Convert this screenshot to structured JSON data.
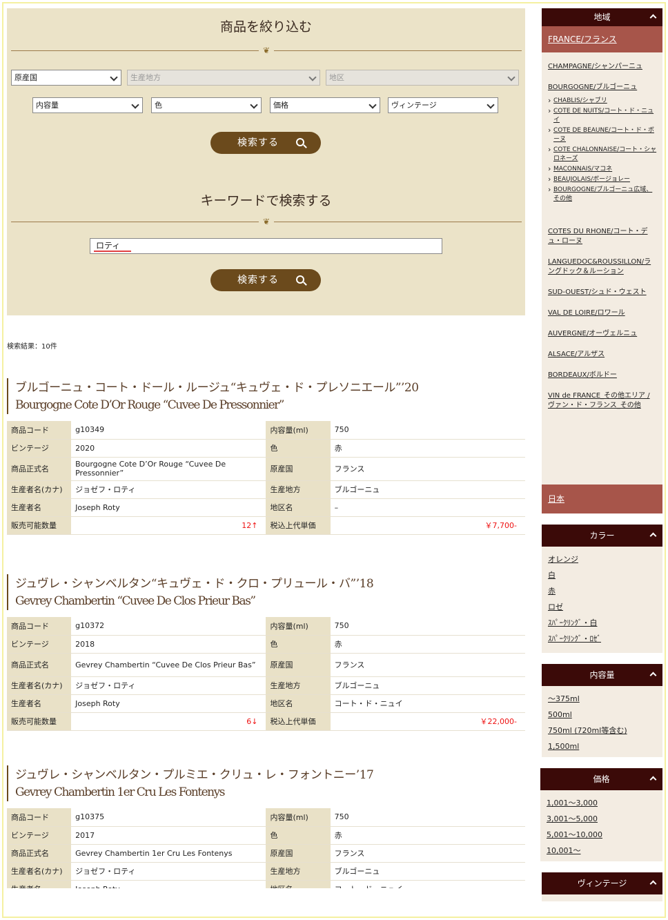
{
  "filter": {
    "title": "商品を絞り込む",
    "country": "原産国",
    "region": "生産地方",
    "district": "地区",
    "volume": "内容量",
    "color": "色",
    "price": "価格",
    "vintage": "ヴィンテージ",
    "search_label": "検索する",
    "keyword_title": "キーワードで検索する",
    "keyword_value": "ロティ",
    "keyword_search_label": "検索する"
  },
  "results": {
    "count_label": "検索結果：10件"
  },
  "labels": {
    "code": "商品コード",
    "volume": "内容量(ml)",
    "vintage": "ビンテージ",
    "color": "色",
    "formal_name": "商品正式名",
    "country": "原産国",
    "producer_kana": "生産者名(カナ)",
    "region": "生産地方",
    "producer": "生産者名",
    "district": "地区名",
    "stock": "販売可能数量",
    "price": "税込上代単価"
  },
  "products": [
    {
      "title_jp": "ブルゴーニュ・コート・ドール・ルージュ“キュヴェ・ド・プレソニエール”’20",
      "title_en": "Bourgogne Cote D’Or Rouge “Cuvee De Pressonnier”",
      "code": "g10349",
      "volume": "750",
      "vintage": "2020",
      "color": "赤",
      "formal_name": "Bourgogne Cote D’Or Rouge “Cuvee De Pressonnier”",
      "country": "フランス",
      "producer_kana": "ジョゼフ・ロティ",
      "region": "ブルゴーニュ",
      "producer": "Joseph Roty",
      "district": "–",
      "stock": "12↑",
      "price": "￥7,700-"
    },
    {
      "title_jp": "ジュヴレ・シャンベルタン“キュヴェ・ド・クロ・プリュール・バ”’18",
      "title_en": "Gevrey Chambertin “Cuvee De Clos Prieur Bas”",
      "code": "g10372",
      "volume": "750",
      "vintage": "2018",
      "color": "赤",
      "formal_name": "Gevrey Chambertin “Cuvee De Clos Prieur Bas”",
      "country": "フランス",
      "producer_kana": "ジョゼフ・ロティ",
      "region": "ブルゴーニュ",
      "producer": "Joseph Roty",
      "district": "コート・ド・ニュイ",
      "stock": "6↓",
      "price": "￥22,000-"
    },
    {
      "title_jp": "ジュヴレ・シャンベルタン・プルミエ・クリュ・レ・フォントニー’17",
      "title_en": "Gevrey Chambertin 1er Cru Les Fontenys",
      "code": "g10375",
      "volume": "750",
      "vintage": "2017",
      "color": "赤",
      "formal_name": "Gevrey Chambertin 1er Cru Les Fontenys",
      "country": "フランス",
      "producer_kana": "ジョゼフ・ロティ",
      "region": "ブルゴーニュ",
      "producer": "Joseph Roty",
      "district": "コート・ド・ニュイ"
    }
  ],
  "sidebar": {
    "region_title": "地域",
    "france": "FRANCE/フランス",
    "regions": [
      "CHAMPAGNE/シャンパーニュ",
      "BOURGOGNE/ブルゴーニュ"
    ],
    "sub_regions": [
      "CHABLIS/シャブリ",
      "COTE DE NUITS/コート・ド・ニュイ",
      "COTE DE BEAUNE/コート・ド・ボーヌ",
      "COTE CHALONNAISE/コート・シャロネーズ",
      "MACONNAIS/マコネ",
      "BEAUJOLAIS/ボージョレー",
      "BOURGOGNE/ブルゴーニュ広域、その他"
    ],
    "regions2": [
      "COTES DU RHONE/コート・デュ・ローヌ",
      "LANGUEDOC&ROUSSILLON/ラングドック＆ルーション",
      "SUD-OUEST/シュド・ウェスト",
      "VAL DE LOIRE/ロワール",
      "AUVERGNE/オーヴェルニュ",
      "ALSACE/アルザス",
      "BORDEAUX/ボルドー",
      "VIN de FRANCE_その他エリア / ヴァン・ド・フランス_その他"
    ],
    "japan": "日本",
    "color_title": "カラー",
    "colors": [
      "オレンジ",
      "白",
      "赤",
      "ロゼ",
      "ｽﾊﾟｰｸﾘﾝｸﾞ・白",
      "ｽﾊﾟｰｸﾘﾝｸﾞ・ﾛｾﾞ"
    ],
    "volume_title": "内容量",
    "volumes": [
      "～375ml",
      "500ml",
      "750ml (720ml等含む)",
      "1,500ml"
    ],
    "price_title": "価格",
    "prices": [
      "1,001～3,000",
      "3,001～5,000",
      "5,001～10,000",
      "10,001～"
    ],
    "vintage_title": "ヴィンテージ"
  }
}
